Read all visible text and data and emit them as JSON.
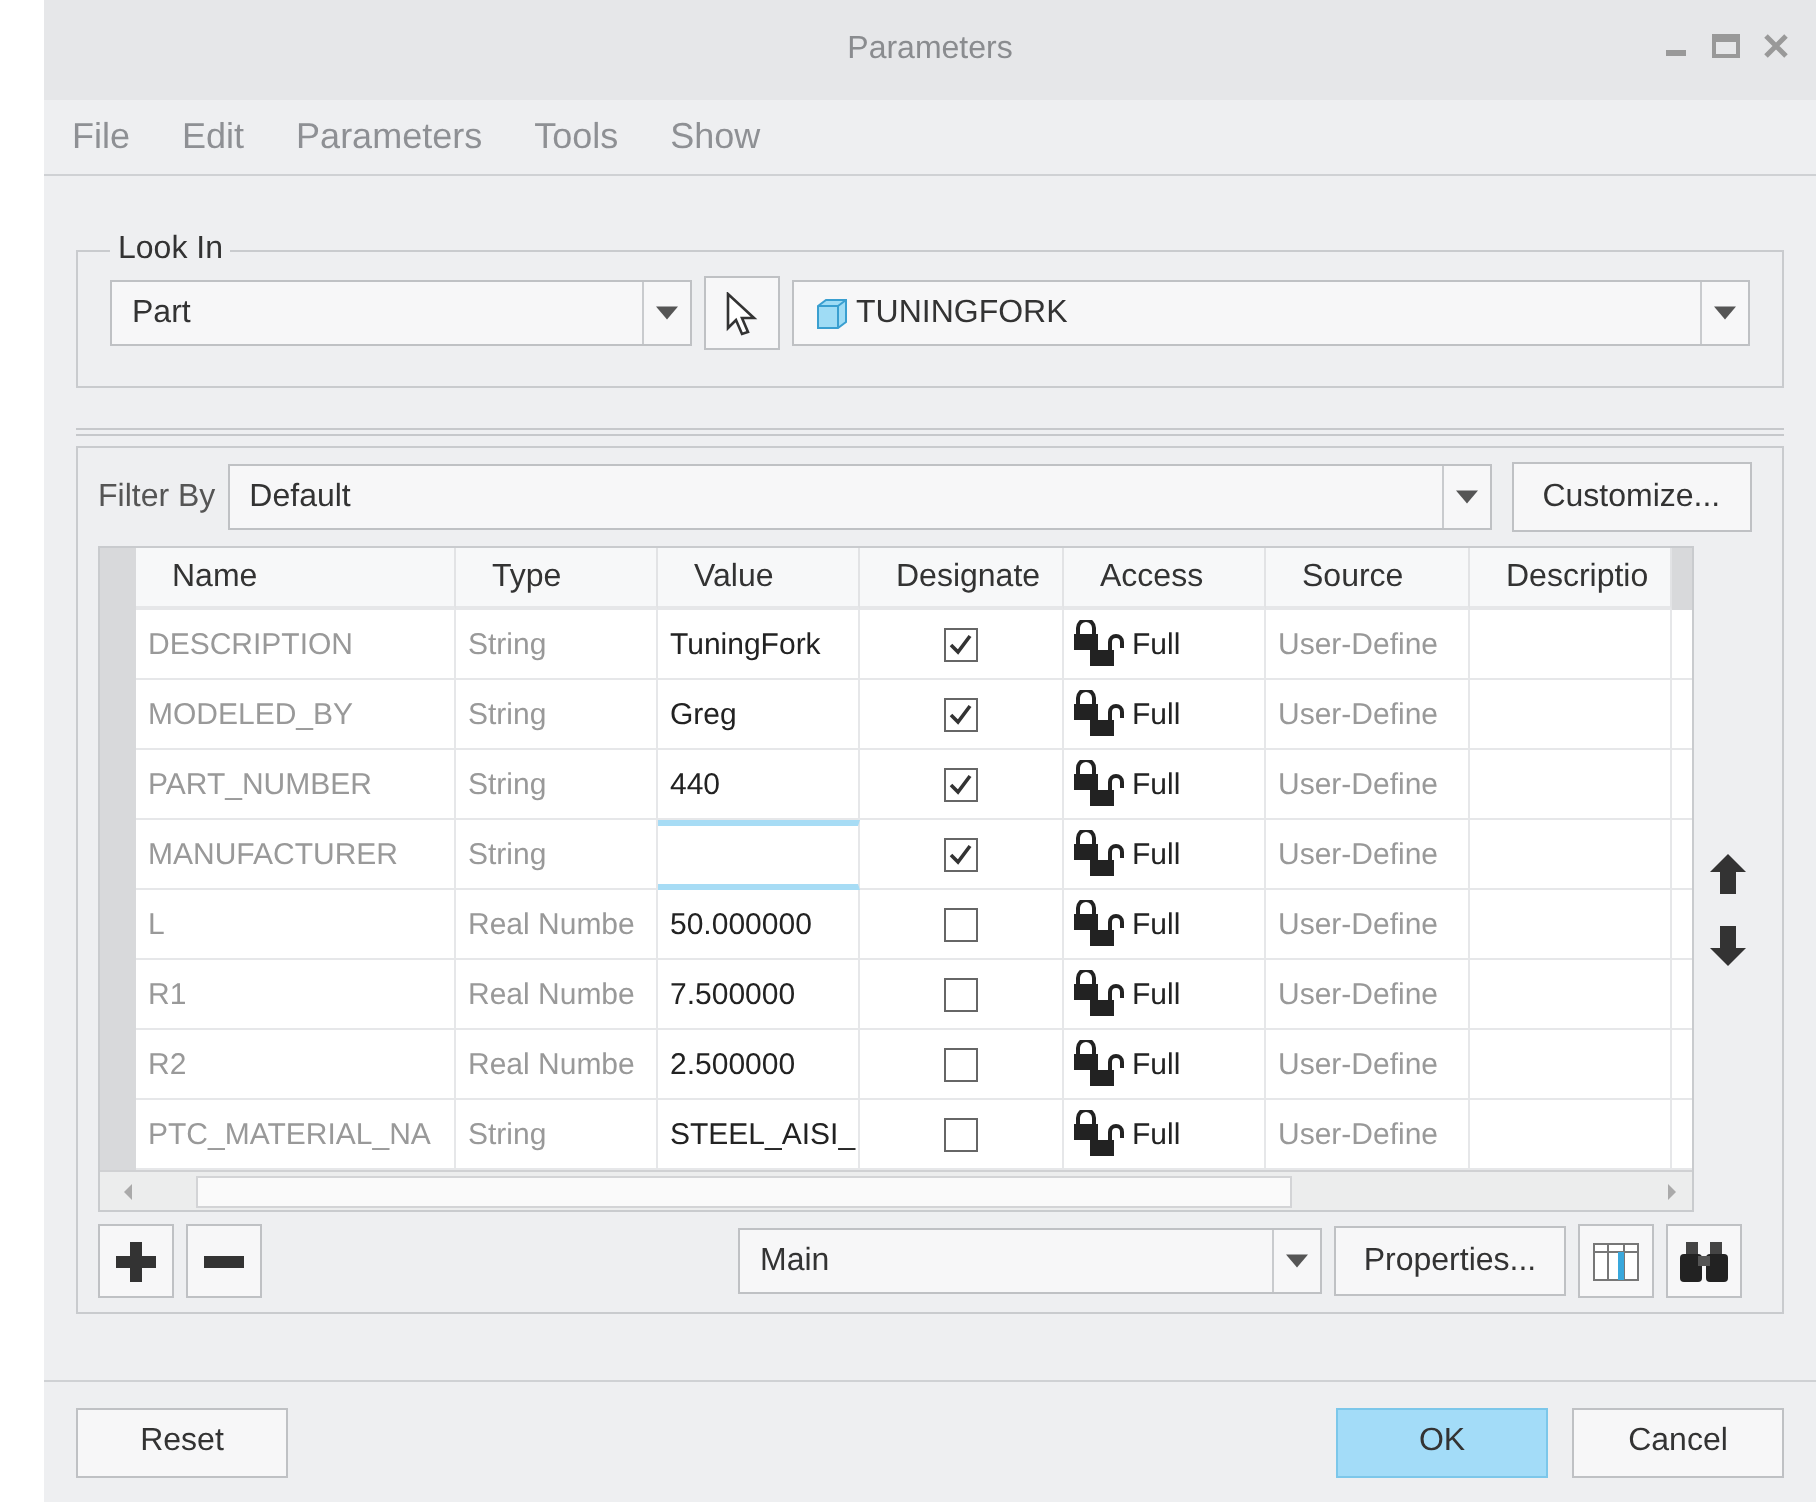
{
  "window": {
    "title": "Parameters"
  },
  "menu": [
    "File",
    "Edit",
    "Parameters",
    "Tools",
    "Show"
  ],
  "look_in": {
    "label": "Look In",
    "scope": "Part",
    "model": "TUNINGFORK"
  },
  "filter": {
    "label": "Filter By",
    "value": "Default",
    "customize": "Customize..."
  },
  "table": {
    "columns": [
      "Name",
      "Type",
      "Value",
      "Designate",
      "Access",
      "Source",
      "Descriptio"
    ],
    "rows": [
      {
        "name": "DESCRIPTION",
        "type": "String",
        "value": "TuningFork",
        "designate": true,
        "access": "Full",
        "source": "User-Define",
        "editing": false
      },
      {
        "name": "MODELED_BY",
        "type": "String",
        "value": "Greg",
        "designate": true,
        "access": "Full",
        "source": "User-Define",
        "editing": false
      },
      {
        "name": "PART_NUMBER",
        "type": "String",
        "value": "440",
        "designate": true,
        "access": "Full",
        "source": "User-Define",
        "editing": false
      },
      {
        "name": "MANUFACTURER",
        "type": "String",
        "value": "",
        "designate": true,
        "access": "Full",
        "source": "User-Define",
        "editing": true
      },
      {
        "name": "L",
        "type": "Real Numbe",
        "value": "50.000000",
        "designate": false,
        "access": "Full",
        "source": "User-Define",
        "editing": false
      },
      {
        "name": "R1",
        "type": "Real Numbe",
        "value": "7.500000",
        "designate": false,
        "access": "Full",
        "source": "User-Define",
        "editing": false
      },
      {
        "name": "R2",
        "type": "Real Numbe",
        "value": "2.500000",
        "designate": false,
        "access": "Full",
        "source": "User-Define",
        "editing": false
      },
      {
        "name": "PTC_MATERIAL_NA",
        "type": "String",
        "value": "STEEL_AISI_",
        "designate": false,
        "access": "Full",
        "source": "User-Define",
        "editing": false
      }
    ]
  },
  "bottom": {
    "view": "Main",
    "properties": "Properties..."
  },
  "buttons": {
    "reset": "Reset",
    "ok": "OK",
    "cancel": "Cancel"
  }
}
